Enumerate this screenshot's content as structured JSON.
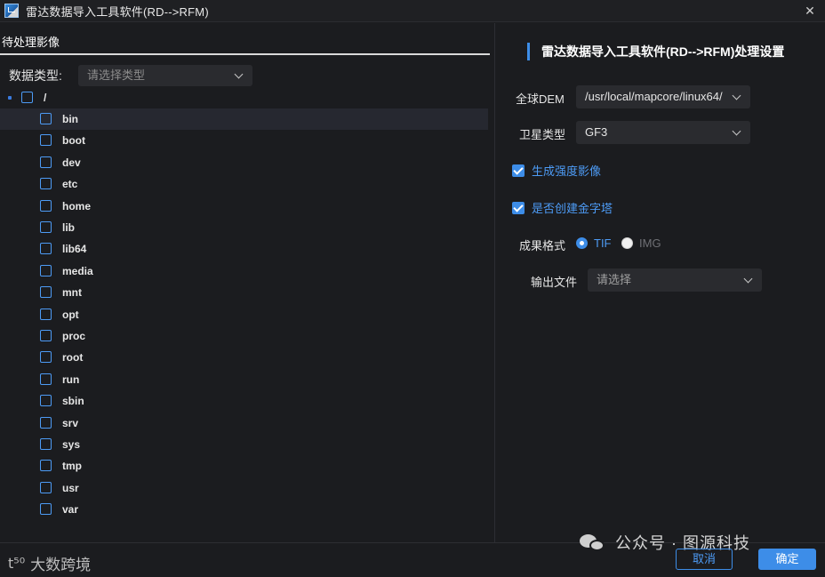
{
  "window": {
    "title": "雷达数据导入工具软件(RD-->RFM)",
    "close_label": "✕"
  },
  "left": {
    "tab_label": "待处理影像",
    "data_type_label": "数据类型:",
    "data_type_placeholder": "请选择类型",
    "tree_root_label": "/",
    "tree_items": [
      "bin",
      "boot",
      "dev",
      "etc",
      "home",
      "lib",
      "lib64",
      "media",
      "mnt",
      "opt",
      "proc",
      "root",
      "run",
      "sbin",
      "srv",
      "sys",
      "tmp",
      "usr",
      "var"
    ],
    "highlighted_item": "bin"
  },
  "right": {
    "title": "雷达数据导入工具软件(RD-->RFM)处理设置",
    "dem_label": "全球DEM",
    "dem_value": "/usr/local/mapcore/linux64/",
    "satellite_label": "卫星类型",
    "satellite_value": "GF3",
    "gen_intensity_label": "生成强度影像",
    "gen_intensity_checked": true,
    "create_pyramid_label": "是否创建金字塔",
    "create_pyramid_checked": true,
    "output_format_label": "成果格式",
    "format_options": [
      {
        "label": "TIF",
        "selected": true
      },
      {
        "label": "IMG",
        "selected": false
      }
    ],
    "output_file_label": "输出文件",
    "output_file_placeholder": "请选择"
  },
  "footer": {
    "brand_mark": "t⁵⁰",
    "brand_text": "大数跨境",
    "watermark_text": "公众号 · 图源科技",
    "cancel_label": "取消",
    "ok_label": "确定"
  },
  "colors": {
    "accent": "#3d8de8",
    "background": "#1b1c1f",
    "field_bg": "#2a2b2f"
  }
}
